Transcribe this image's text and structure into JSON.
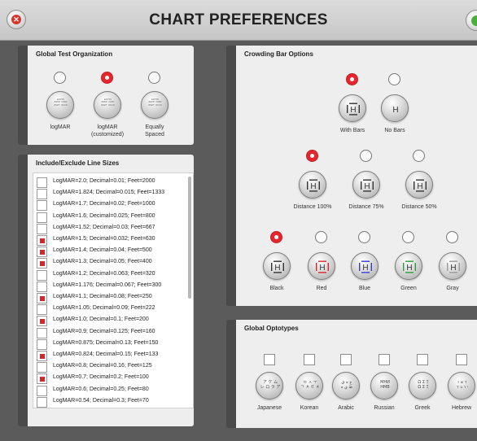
{
  "window": {
    "title": "CHART PREFERENCES"
  },
  "colors": {
    "accent": "#e8252d",
    "ok": "#4cae3c"
  },
  "global_test_org": {
    "title": "Global Test Organization",
    "options": [
      {
        "label": "logMAR",
        "selected": false
      },
      {
        "label": "logMAR (customized)",
        "selected": true
      },
      {
        "label": "Equally Spaced",
        "selected": false
      }
    ]
  },
  "crowding_bar": {
    "title": "Crowding Bar Options",
    "bars": [
      {
        "label": "With Bars",
        "selected": true
      },
      {
        "label": "No Bars",
        "selected": false
      }
    ],
    "distance": [
      {
        "label": "Distance 100%",
        "selected": true
      },
      {
        "label": "Distance 75%",
        "selected": false
      },
      {
        "label": "Distance 50%",
        "selected": false
      }
    ],
    "colors": [
      {
        "label": "Black",
        "selected": true,
        "color": "#333333"
      },
      {
        "label": "Red",
        "selected": false,
        "color": "#d8252b"
      },
      {
        "label": "Blue",
        "selected": false,
        "color": "#2b3fd8"
      },
      {
        "label": "Green",
        "selected": false,
        "color": "#2f9d3a"
      },
      {
        "label": "Gray",
        "selected": false,
        "color": "#9a9a9a"
      }
    ]
  },
  "line_sizes": {
    "title": "Include/Exclude Line Sizes",
    "rows": [
      {
        "text": "LogMAR=2.0; Decimal=0.01; Feet=2000",
        "checked": false
      },
      {
        "text": "LogMAR=1.824; Decimal=0.015; Feet=1333",
        "checked": false
      },
      {
        "text": "LogMAR=1.7; Decimal=0.02; Feet=1000",
        "checked": false
      },
      {
        "text": "LogMAR=1.6; Decimal=0.025; Feet=800",
        "checked": false
      },
      {
        "text": "LogMAR=1.52; Decimal=0.03; Feet=667",
        "checked": false
      },
      {
        "text": "LogMAR=1.5; Decimal=0.032; Feet=630",
        "checked": true
      },
      {
        "text": "LogMAR=1.4; Decimal=0.04; Feet=500",
        "checked": true
      },
      {
        "text": "LogMAR=1.3; Decimal=0.05; Feet=400",
        "checked": true
      },
      {
        "text": "LogMAR=1.2; Decimal=0.063; Feet=320",
        "checked": false
      },
      {
        "text": "LogMAR=1.176; Decimal=0.067; Feet=300",
        "checked": false
      },
      {
        "text": "LogMAR=1.1; Decimal=0.08; Feet=250",
        "checked": true
      },
      {
        "text": "LogMAR=1.05; Decimal=0.09; Feet=222",
        "checked": false
      },
      {
        "text": "LogMAR=1.0; Decimal=0.1; Feet=200",
        "checked": true
      },
      {
        "text": "LogMAR=0.9; Decimal=0.125; Feet=160",
        "checked": false
      },
      {
        "text": "LogMAR=0.875; Decimal=0.13; Feet=150",
        "checked": false
      },
      {
        "text": "LogMAR=0.824; Decimal=0.15; Feet=133",
        "checked": true
      },
      {
        "text": "LogMAR=0.8; Decimal=0.16; Feet=125",
        "checked": false
      },
      {
        "text": "LogMAR=0.7; Decimal=0.2; Feet=100",
        "checked": true
      },
      {
        "text": "LogMAR=0.6; Decimal=0.25; Feet=80",
        "checked": false
      },
      {
        "text": "LogMAR=0.54; Decimal=0.3; Feet=70",
        "checked": false
      }
    ]
  },
  "optotypes": {
    "title": "Global Optotypes",
    "items": [
      {
        "label": "Japanese",
        "glyphs": "ア ケ ム\nレ ロ ラ ア",
        "checked": false
      },
      {
        "label": "Korean",
        "glyphs": "ㅂ ㅅ ㅜ\nㄱ ㅊ ㅌ ㅊ",
        "checked": false
      },
      {
        "label": "Arabic",
        "glyphs": "ج ه ق\nظ ي ه",
        "checked": false
      },
      {
        "label": "Russian",
        "glyphs": "МНИ\nНМВ",
        "checked": false
      },
      {
        "label": "Greek",
        "glyphs": "Ω Σ Ξ\nΩ Σ Ξ",
        "checked": false
      },
      {
        "label": "Hebrew",
        "glyphs": "ד ש ז\nי ר ב ד",
        "checked": false
      }
    ]
  }
}
